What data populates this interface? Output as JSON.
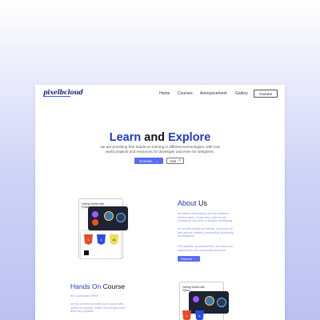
{
  "brand": {
    "logo_text": "pixelbcloud"
  },
  "nav": {
    "items": [
      "Home",
      "Courses",
      "Announcement",
      "Gallery"
    ],
    "youtube_label": "Youtube"
  },
  "hero": {
    "title_part1": "Learn",
    "title_part2": " and ",
    "title_part3": "Explore",
    "subtitle": "we are providing free hands-on training in different technologies, with real world projects and resources for developer and even for designers.",
    "courses_button": "Courses",
    "visit_button": "Visit"
  },
  "illustration": {
    "card_text": "Getting Started with Python"
  },
  "about": {
    "title_part1": "About",
    "title_part2": " Us",
    "paragraphs": [
      "we believe that anyone can be whatever he/she wants, it was only a fact for his confidence and work to achieve something.",
      "we provide hands-on training, resources for free and an initiative (community) especially for designers.",
      "Get updates, announcement, and roles you require from our community members."
    ],
    "discover_button": "Discover"
  },
  "hands_on": {
    "title_part1": "Hands On",
    "title_part2": " Course",
    "paragraphs": [
      "All Courses are FREE",
      "we try our best to create such course with hands on practice related and beside you'll learn any possible"
    ]
  },
  "colors": {
    "accent": "#1f3cc4",
    "button": "#5a6cf0",
    "muted_text": "#8a94d8",
    "background_gradient_end": "#bcc1f2"
  }
}
